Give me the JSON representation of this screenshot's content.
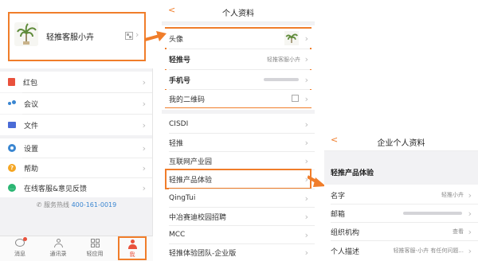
{
  "colors": {
    "accent": "#f07d2a",
    "bg_gray": "#f2f2f4",
    "link_blue": "#3a86d1"
  },
  "panel1": {
    "profile": {
      "name": "轻推客服小卉",
      "qr_icon": "qr-code-icon"
    },
    "menu": [
      {
        "label": "红包",
        "icon": "red-packet-icon",
        "color": "#e9513c"
      },
      {
        "label": "会议",
        "icon": "people-icon",
        "color": "#3a86d1"
      },
      {
        "label": "文件",
        "icon": "folder-icon",
        "color": "#4a6bd6"
      },
      {
        "label": "设置",
        "icon": "gear-icon",
        "color": "#3a86d1"
      },
      {
        "label": "帮助",
        "icon": "question-icon",
        "color": "#f5a623"
      },
      {
        "label": "在线客服&意见反馈",
        "icon": "chat-icon",
        "color": "#2bb673"
      }
    ],
    "hotline_label": "服务热线",
    "hotline_number": "400-161-0019",
    "tabs": [
      {
        "label": "消息",
        "icon": "message-icon"
      },
      {
        "label": "通讯录",
        "icon": "contacts-icon"
      },
      {
        "label": "轻应用",
        "icon": "apps-grid-icon"
      },
      {
        "label": "我",
        "icon": "person-icon"
      }
    ]
  },
  "panel2": {
    "title": "个人资料",
    "back": "<",
    "profile_rows": [
      {
        "label": "头像"
      },
      {
        "label": "轻推号",
        "value": "轻推客服小卉"
      },
      {
        "label": "手机号"
      },
      {
        "label": "我的二维码"
      }
    ],
    "org_rows": [
      "CISDI",
      "轻推",
      "互联网产业园",
      "轻推产品体验",
      "QingTui",
      "中冶赛迪校园招聘",
      "MCC",
      "轻推体验团队-企业版"
    ]
  },
  "panel3": {
    "title": "企业个人资料",
    "back": "<",
    "section": "轻推产品体验",
    "rows": [
      {
        "label": "名字",
        "value": "轻推小卉"
      },
      {
        "label": "邮箱",
        "value": ""
      },
      {
        "label": "组织机构",
        "value": "查看"
      },
      {
        "label": "个人描述",
        "value": "轻推客服-小卉 有任何问题..."
      }
    ]
  }
}
